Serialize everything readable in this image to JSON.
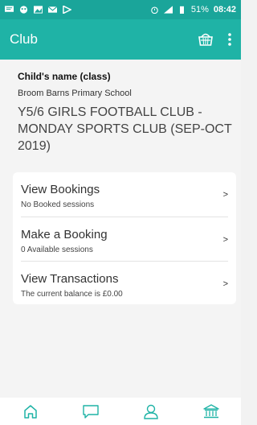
{
  "status_bar": {
    "battery": "51%",
    "time": "08:42",
    "icons": [
      "message-icon",
      "face-icon",
      "image-icon",
      "mail-icon",
      "play-icon",
      "alarm-icon",
      "signal-icon",
      "battery-icon"
    ]
  },
  "app_bar": {
    "title": "Club",
    "actions": [
      "basket-icon",
      "more-vert-icon"
    ]
  },
  "header": {
    "child_name": "Child's name (class)",
    "school": "Broom Barns Primary School",
    "club_title": "Y5/6 GIRLS FOOTBALL CLUB - MONDAY SPORTS CLUB (SEP-OCT 2019)"
  },
  "menu": [
    {
      "label": "View Bookings",
      "sub": "No Booked sessions",
      "chevron": ">"
    },
    {
      "label": "Make a Booking",
      "sub": "0 Available sessions",
      "chevron": ">"
    },
    {
      "label": "View Transactions",
      "sub": "The current balance is £0.00",
      "chevron": ">"
    }
  ],
  "bottom_nav": [
    "home-icon",
    "chat-icon",
    "profile-icon",
    "bank-icon"
  ],
  "colors": {
    "accent": "#1fb3a6",
    "status_bar": "#1aa59a",
    "nav_icon": "#1fb3a6"
  }
}
